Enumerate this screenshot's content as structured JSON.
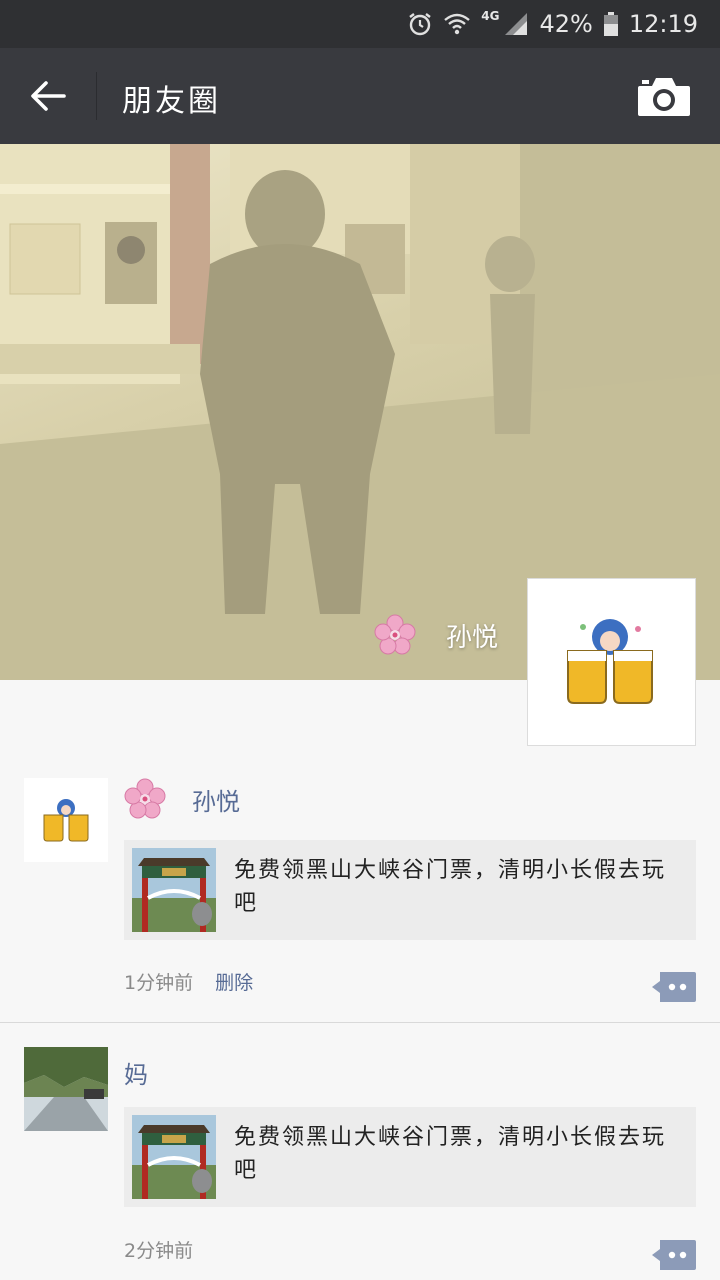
{
  "status_bar": {
    "network": "4G",
    "battery": "42%",
    "time": "12:19",
    "icons": [
      "alarm-icon",
      "wifi-icon",
      "signal-icon",
      "battery-icon"
    ]
  },
  "title_bar": {
    "title": "朋友圈",
    "back_icon": "arrow-left-icon",
    "camera_icon": "camera-icon"
  },
  "cover": {
    "name": "孙悦",
    "name_icon": "flower-emoji-icon"
  },
  "posts": [
    {
      "name": "孙悦",
      "name_icon": "flower-emoji-icon",
      "share_text": "免费领黑山大峡谷门票，清明小长假去玩吧",
      "time": "1分钟前",
      "delete_label": "删除",
      "comment_icon": "comment-bubble-icon"
    },
    {
      "name": "妈",
      "share_text": "免费领黑山大峡谷门票，清明小长假去玩吧",
      "time": "2分钟前",
      "comment_icon": "comment-bubble-icon"
    }
  ],
  "colors": {
    "status_bar": "#2f3033",
    "title_bar": "#393a3f",
    "link": "#576b95",
    "background": "#f7f7f7"
  }
}
